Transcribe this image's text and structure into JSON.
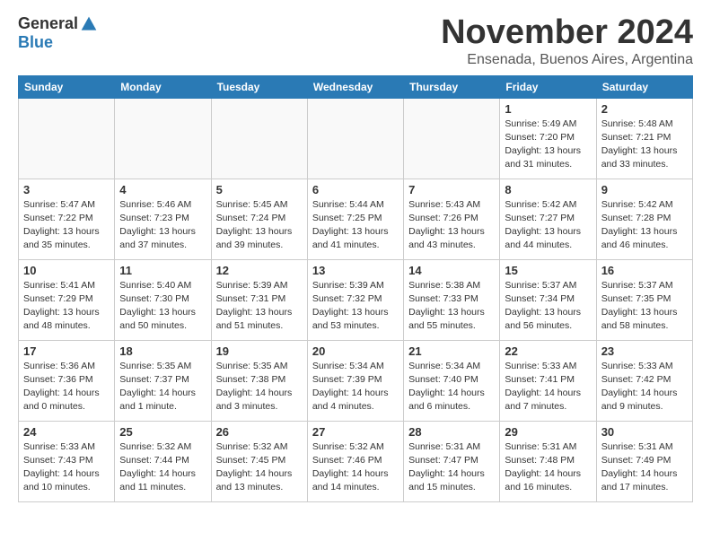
{
  "header": {
    "logo_general": "General",
    "logo_blue": "Blue",
    "month_title": "November 2024",
    "location": "Ensenada, Buenos Aires, Argentina"
  },
  "weekdays": [
    "Sunday",
    "Monday",
    "Tuesday",
    "Wednesday",
    "Thursday",
    "Friday",
    "Saturday"
  ],
  "weeks": [
    [
      {
        "day": "",
        "info": ""
      },
      {
        "day": "",
        "info": ""
      },
      {
        "day": "",
        "info": ""
      },
      {
        "day": "",
        "info": ""
      },
      {
        "day": "",
        "info": ""
      },
      {
        "day": "1",
        "info": "Sunrise: 5:49 AM\nSunset: 7:20 PM\nDaylight: 13 hours\nand 31 minutes."
      },
      {
        "day": "2",
        "info": "Sunrise: 5:48 AM\nSunset: 7:21 PM\nDaylight: 13 hours\nand 33 minutes."
      }
    ],
    [
      {
        "day": "3",
        "info": "Sunrise: 5:47 AM\nSunset: 7:22 PM\nDaylight: 13 hours\nand 35 minutes."
      },
      {
        "day": "4",
        "info": "Sunrise: 5:46 AM\nSunset: 7:23 PM\nDaylight: 13 hours\nand 37 minutes."
      },
      {
        "day": "5",
        "info": "Sunrise: 5:45 AM\nSunset: 7:24 PM\nDaylight: 13 hours\nand 39 minutes."
      },
      {
        "day": "6",
        "info": "Sunrise: 5:44 AM\nSunset: 7:25 PM\nDaylight: 13 hours\nand 41 minutes."
      },
      {
        "day": "7",
        "info": "Sunrise: 5:43 AM\nSunset: 7:26 PM\nDaylight: 13 hours\nand 43 minutes."
      },
      {
        "day": "8",
        "info": "Sunrise: 5:42 AM\nSunset: 7:27 PM\nDaylight: 13 hours\nand 44 minutes."
      },
      {
        "day": "9",
        "info": "Sunrise: 5:42 AM\nSunset: 7:28 PM\nDaylight: 13 hours\nand 46 minutes."
      }
    ],
    [
      {
        "day": "10",
        "info": "Sunrise: 5:41 AM\nSunset: 7:29 PM\nDaylight: 13 hours\nand 48 minutes."
      },
      {
        "day": "11",
        "info": "Sunrise: 5:40 AM\nSunset: 7:30 PM\nDaylight: 13 hours\nand 50 minutes."
      },
      {
        "day": "12",
        "info": "Sunrise: 5:39 AM\nSunset: 7:31 PM\nDaylight: 13 hours\nand 51 minutes."
      },
      {
        "day": "13",
        "info": "Sunrise: 5:39 AM\nSunset: 7:32 PM\nDaylight: 13 hours\nand 53 minutes."
      },
      {
        "day": "14",
        "info": "Sunrise: 5:38 AM\nSunset: 7:33 PM\nDaylight: 13 hours\nand 55 minutes."
      },
      {
        "day": "15",
        "info": "Sunrise: 5:37 AM\nSunset: 7:34 PM\nDaylight: 13 hours\nand 56 minutes."
      },
      {
        "day": "16",
        "info": "Sunrise: 5:37 AM\nSunset: 7:35 PM\nDaylight: 13 hours\nand 58 minutes."
      }
    ],
    [
      {
        "day": "17",
        "info": "Sunrise: 5:36 AM\nSunset: 7:36 PM\nDaylight: 14 hours\nand 0 minutes."
      },
      {
        "day": "18",
        "info": "Sunrise: 5:35 AM\nSunset: 7:37 PM\nDaylight: 14 hours\nand 1 minute."
      },
      {
        "day": "19",
        "info": "Sunrise: 5:35 AM\nSunset: 7:38 PM\nDaylight: 14 hours\nand 3 minutes."
      },
      {
        "day": "20",
        "info": "Sunrise: 5:34 AM\nSunset: 7:39 PM\nDaylight: 14 hours\nand 4 minutes."
      },
      {
        "day": "21",
        "info": "Sunrise: 5:34 AM\nSunset: 7:40 PM\nDaylight: 14 hours\nand 6 minutes."
      },
      {
        "day": "22",
        "info": "Sunrise: 5:33 AM\nSunset: 7:41 PM\nDaylight: 14 hours\nand 7 minutes."
      },
      {
        "day": "23",
        "info": "Sunrise: 5:33 AM\nSunset: 7:42 PM\nDaylight: 14 hours\nand 9 minutes."
      }
    ],
    [
      {
        "day": "24",
        "info": "Sunrise: 5:33 AM\nSunset: 7:43 PM\nDaylight: 14 hours\nand 10 minutes."
      },
      {
        "day": "25",
        "info": "Sunrise: 5:32 AM\nSunset: 7:44 PM\nDaylight: 14 hours\nand 11 minutes."
      },
      {
        "day": "26",
        "info": "Sunrise: 5:32 AM\nSunset: 7:45 PM\nDaylight: 14 hours\nand 13 minutes."
      },
      {
        "day": "27",
        "info": "Sunrise: 5:32 AM\nSunset: 7:46 PM\nDaylight: 14 hours\nand 14 minutes."
      },
      {
        "day": "28",
        "info": "Sunrise: 5:31 AM\nSunset: 7:47 PM\nDaylight: 14 hours\nand 15 minutes."
      },
      {
        "day": "29",
        "info": "Sunrise: 5:31 AM\nSunset: 7:48 PM\nDaylight: 14 hours\nand 16 minutes."
      },
      {
        "day": "30",
        "info": "Sunrise: 5:31 AM\nSunset: 7:49 PM\nDaylight: 14 hours\nand 17 minutes."
      }
    ]
  ]
}
